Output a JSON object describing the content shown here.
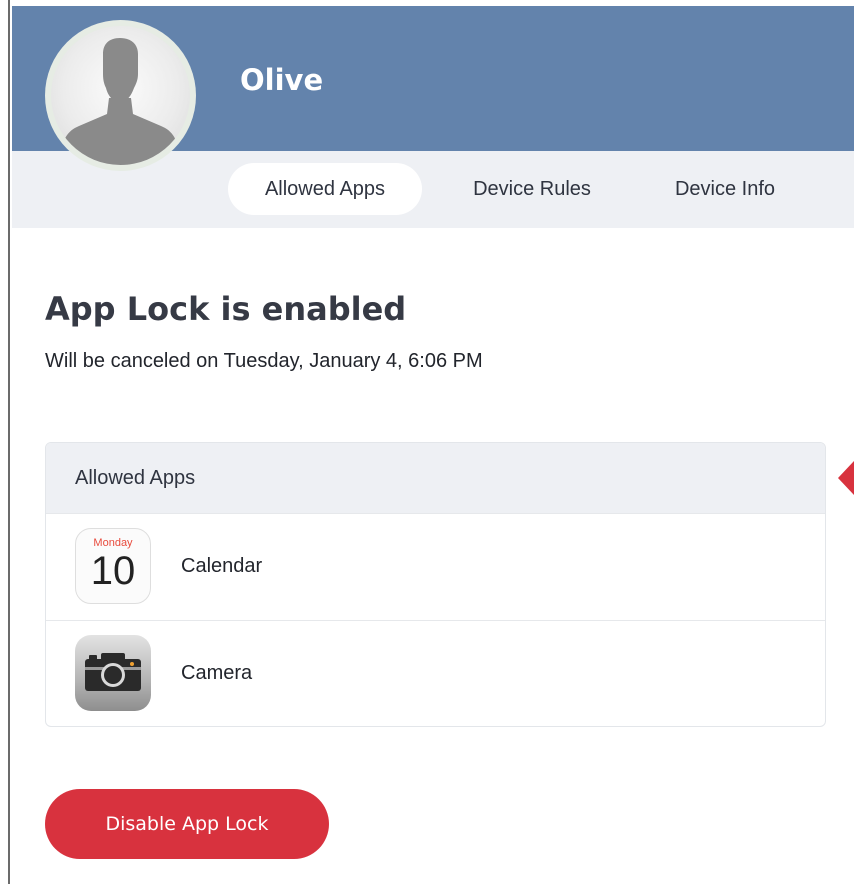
{
  "profile": {
    "name": "Olive",
    "avatar_icon": "person-silhouette-icon"
  },
  "tabs": [
    {
      "label": "Allowed Apps",
      "active": true
    },
    {
      "label": "Device Rules",
      "active": false
    },
    {
      "label": "Device Info",
      "active": false
    }
  ],
  "status": {
    "title": "App Lock is enabled",
    "subtitle": "Will be canceled on Tuesday, January 4, 6:06 PM"
  },
  "allowed_apps": {
    "header": "Allowed Apps",
    "items": [
      {
        "name": "Calendar",
        "icon": "calendar-icon",
        "icon_day": "Monday",
        "icon_date": "10"
      },
      {
        "name": "Camera",
        "icon": "camera-icon"
      }
    ]
  },
  "actions": {
    "disable_label": "Disable App Lock"
  },
  "colors": {
    "header_bg": "#6383ac",
    "tabbar_bg": "#eef0f4",
    "danger": "#d8323e"
  }
}
